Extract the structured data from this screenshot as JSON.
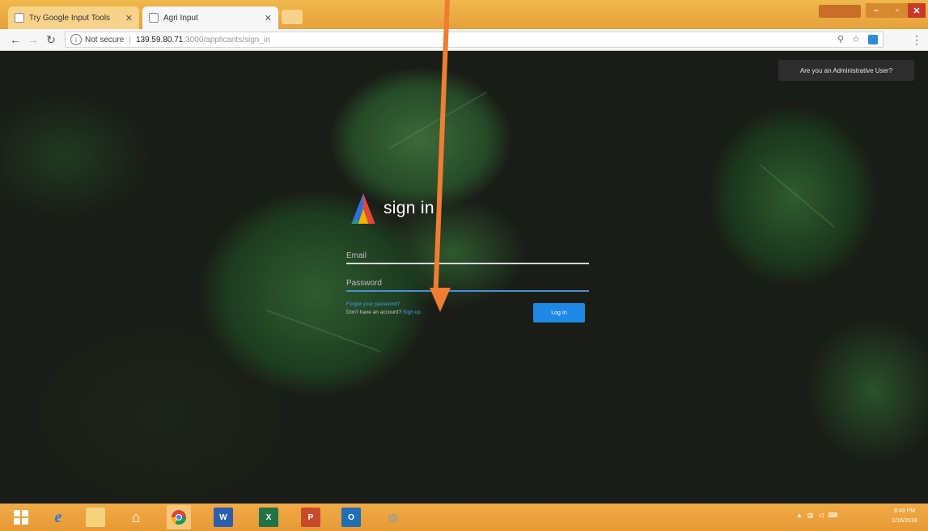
{
  "browser": {
    "tabs": [
      {
        "title": "Try Google Input Tools"
      },
      {
        "title": "Agri Input"
      }
    ],
    "user_chip": "",
    "address": {
      "security": "Not secure",
      "host": "139.59.80.71",
      "path": ":3000/applicants/sign_in"
    }
  },
  "page": {
    "admin_button": "Are you an Administrative User?",
    "title": "sign in",
    "email_placeholder": "Email",
    "password_placeholder": "Password",
    "forgot_link": "Forgot your password?",
    "signup_prompt": "Don't have an account?",
    "signup_link": "Sign up",
    "login_button": "Log In"
  },
  "colors": {
    "accent": "#1e88e5",
    "arrow": "#ef7d32",
    "taskbar": "#e79a35"
  },
  "taskbar": {
    "clock_time": "8:43 PM",
    "clock_date": "1/16/2018"
  }
}
